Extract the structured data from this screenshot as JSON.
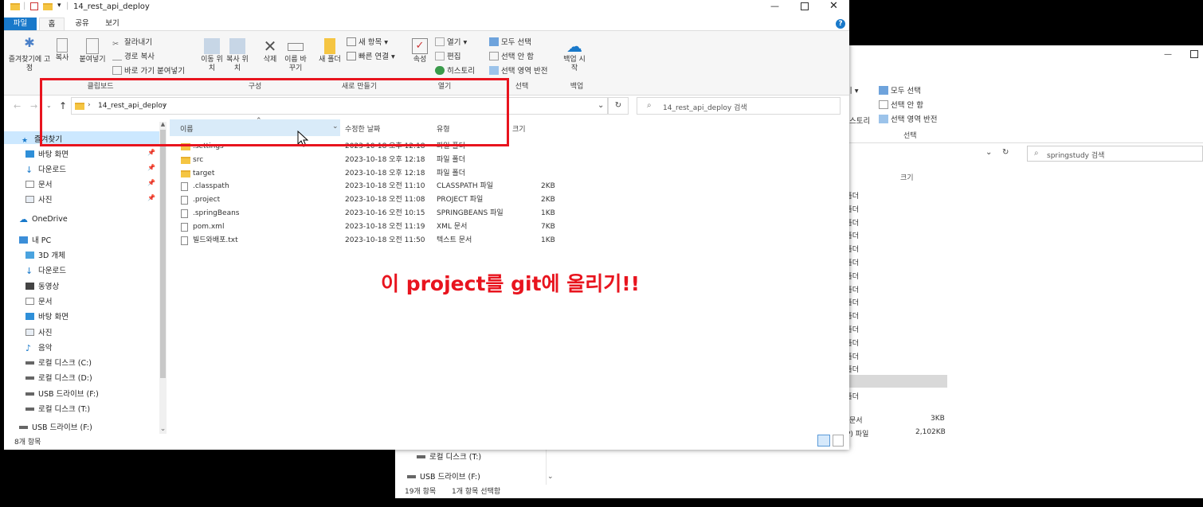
{
  "front": {
    "title": "14_rest_api_deploy",
    "tabs": [
      "파일",
      "홈",
      "공유",
      "보기"
    ],
    "ribbon": {
      "pin_label": "즐겨찾기에 고정",
      "copy": "복사",
      "paste": "붙여넣기",
      "cut": "잘라내기",
      "copy_path": "경로 복사",
      "paste_shortcut": "바로 가기 붙여넣기",
      "move_to": "이동 위치",
      "copy_to": "복사 위치",
      "delete": "삭제",
      "rename": "이름 바꾸기",
      "new_folder": "새 폴더",
      "new_item": "새 항목 ▾",
      "easy_access": "빠른 연결 ▾",
      "properties": "속성",
      "open": "열기 ▾",
      "edit": "편집",
      "history": "히스토리",
      "select_all": "모두 선택",
      "select_none": "선택 안 함",
      "invert_selection": "선택 영역 반전",
      "backup": "백업 시작",
      "groups": [
        "클립보드",
        "구성",
        "새로 만들기",
        "열기",
        "선택",
        "백업"
      ]
    },
    "address": {
      "path": "14_rest_api_deploy",
      "search_placeholder": "14_rest_api_deploy 검색"
    },
    "columns": [
      "이름",
      "수정한 날짜",
      "유형",
      "크기"
    ],
    "files": [
      {
        "name": ".settings",
        "date": "2023-10-18 오후 12:18",
        "type": "파일 폴더",
        "size": "",
        "kind": "folder"
      },
      {
        "name": "src",
        "date": "2023-10-18 오후 12:18",
        "type": "파일 폴더",
        "size": "",
        "kind": "folder"
      },
      {
        "name": "target",
        "date": "2023-10-18 오후 12:18",
        "type": "파일 폴더",
        "size": "",
        "kind": "folder"
      },
      {
        "name": ".classpath",
        "date": "2023-10-18 오전 11:10",
        "type": "CLASSPATH 파일",
        "size": "2KB",
        "kind": "file"
      },
      {
        "name": ".project",
        "date": "2023-10-18 오전 11:08",
        "type": "PROJECT 파일",
        "size": "2KB",
        "kind": "file"
      },
      {
        "name": ".springBeans",
        "date": "2023-10-16 오전 10:15",
        "type": "SPRINGBEANS 파일",
        "size": "1KB",
        "kind": "file"
      },
      {
        "name": "pom.xml",
        "date": "2023-10-18 오전 11:19",
        "type": "XML 문서",
        "size": "7KB",
        "kind": "file"
      },
      {
        "name": "빌드와배포.txt",
        "date": "2023-10-18 오전 11:50",
        "type": "텍스트 문서",
        "size": "1KB",
        "kind": "file"
      }
    ],
    "nav": {
      "quick_access": "즐겨찾기",
      "quick_items": [
        "바탕 화면",
        "다운로드",
        "문서",
        "사진"
      ],
      "onedrive": "OneDrive",
      "this_pc": "내 PC",
      "pc_items": [
        "3D 개체",
        "다운로드",
        "동영상",
        "문서",
        "바탕 화면",
        "사진",
        "음악",
        "로컬 디스크 (C:)",
        "로컬 디스크 (D:)",
        "USB 드라이브 (F:)",
        "로컬 디스크 (T:)"
      ],
      "usb": "USB 드라이브 (F:)"
    },
    "status": "8개 항목",
    "annotation": "이 project를 git에 올리기!!"
  },
  "back": {
    "ribbon": {
      "select_all": "모두 선택",
      "select_none": "선택 안 함",
      "invert_selection": "선택 영역 반전",
      "group_select": "선택",
      "history_partial": "스토리",
      "open_partial": "기 ▾"
    },
    "search_placeholder": "springstudy 검색",
    "size_col": "크기",
    "rows_partial": [
      "폴더",
      "폴더",
      "폴더",
      "폴더",
      "폴더",
      "폴더",
      "폴더",
      "폴더",
      "폴더",
      "폴더",
      "폴더",
      "폴더",
      "폴더",
      "폴더",
      "폴더",
      "폴더"
    ],
    "extra_rows": [
      {
        "type": "문서",
        "size": "3KB"
      },
      {
        "type": "P) 파일",
        "size": "2,102KB"
      }
    ],
    "nav_items": [
      "로컬 디스크 (T:)",
      "USB 드라이브 (F:)"
    ],
    "status_count": "19개 항목",
    "status_selected": "1개 항목 선택함"
  },
  "colors": {
    "accent": "#1979ca",
    "annotation": "#e8141e",
    "selection": "#cce8ff"
  }
}
